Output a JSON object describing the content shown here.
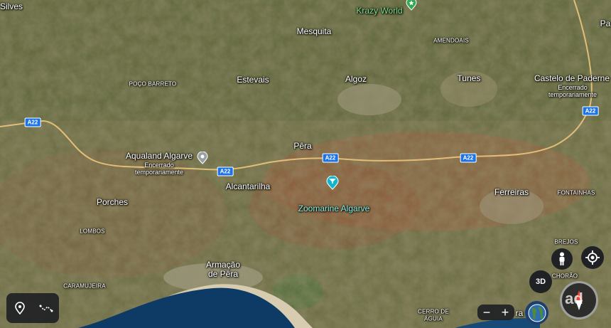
{
  "towns": {
    "silves": "Silves",
    "mesquita": "Mesquita",
    "estevais": "Estevais",
    "algoz": "Algoz",
    "tunes": "Tunes",
    "castelo": "Castelo de Paderne",
    "pera": "Pêra",
    "alcantarilha": "Alcantarilha",
    "porches": "Porches",
    "ferreiras": "Ferreiras",
    "armacao_line1": "Armação",
    "armacao_line2": "de Pêra",
    "pa_partial": "Pa"
  },
  "localities": {
    "poco_barreto": "POÇO BARRETO",
    "amendoais": "AMENDOAIS",
    "lombos": "LOMBOS",
    "caramujeira": "CARAMUJEIRA",
    "fontainhas": "FONTAINHAS",
    "brejos": "BREJOS",
    "cerro_line1": "CERRO DE",
    "cerro_line2": "ÁGUIA",
    "chorao_partial": "CHORÃO"
  },
  "pois": {
    "krazy_world": "Krazy World",
    "aqualand": "Aqualand Algarve",
    "aqualand_status1": "Encerrado",
    "aqualand_status2": "temporariamente",
    "castelo_status1": "Encerrado",
    "castelo_status2": "temporariamente",
    "zoomarine": "Zoomarine Algarve"
  },
  "roads": {
    "a22": "A22"
  },
  "controls": {
    "zoom_in": "+",
    "zoom_out": "−",
    "view_3d": "3D",
    "partial_place": "ra",
    "watermark": "ad"
  },
  "colors": {
    "road": "#e8c27a",
    "shield": "#1a73e8",
    "sea": "#0d3b66",
    "control_bg": "#202124"
  }
}
